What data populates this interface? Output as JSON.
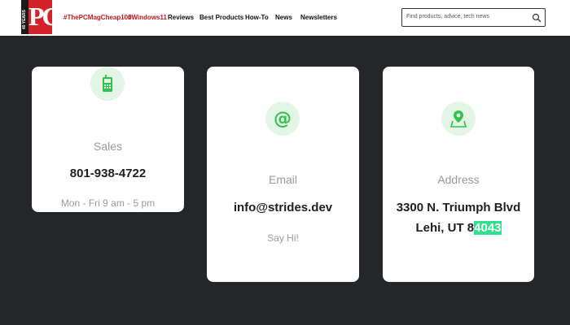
{
  "header": {
    "logo": {
      "main": "PC",
      "band": "40 YEARS"
    },
    "nav": [
      {
        "label": "#ThePCMagCheap100",
        "highlight": true
      },
      {
        "label": "#Windows11",
        "highlight": true
      },
      {
        "label": "Reviews",
        "highlight": false
      },
      {
        "label": "Best Products",
        "highlight": false
      },
      {
        "label": "How-To",
        "highlight": false
      },
      {
        "label": "News",
        "highlight": false
      },
      {
        "label": "Newsletters",
        "highlight": false
      }
    ],
    "search": {
      "placeholder": "Find products, advice, tech news",
      "icon": "search-icon"
    }
  },
  "cards": {
    "sales": {
      "icon": "phone-icon",
      "label": "Sales",
      "value": "801-938-4722",
      "note": "Mon - Fri 9 am - 5 pm"
    },
    "email": {
      "icon": "at-sign-icon",
      "label": "Email",
      "value": "info@strides.dev",
      "note": "Say Hi!"
    },
    "address": {
      "icon": "map-pin-icon",
      "label": "Address",
      "line1": "3300 N. Triumph Blvd",
      "line2_prefix": "Lehi, UT 8",
      "line2_selected": "4043"
    }
  },
  "colors": {
    "accent_green": "#33c24d",
    "icon_bg": "#e3f6e6",
    "selection": "#2fe08f",
    "brand_red": "#d2232a",
    "page_bg": "#24262a"
  }
}
